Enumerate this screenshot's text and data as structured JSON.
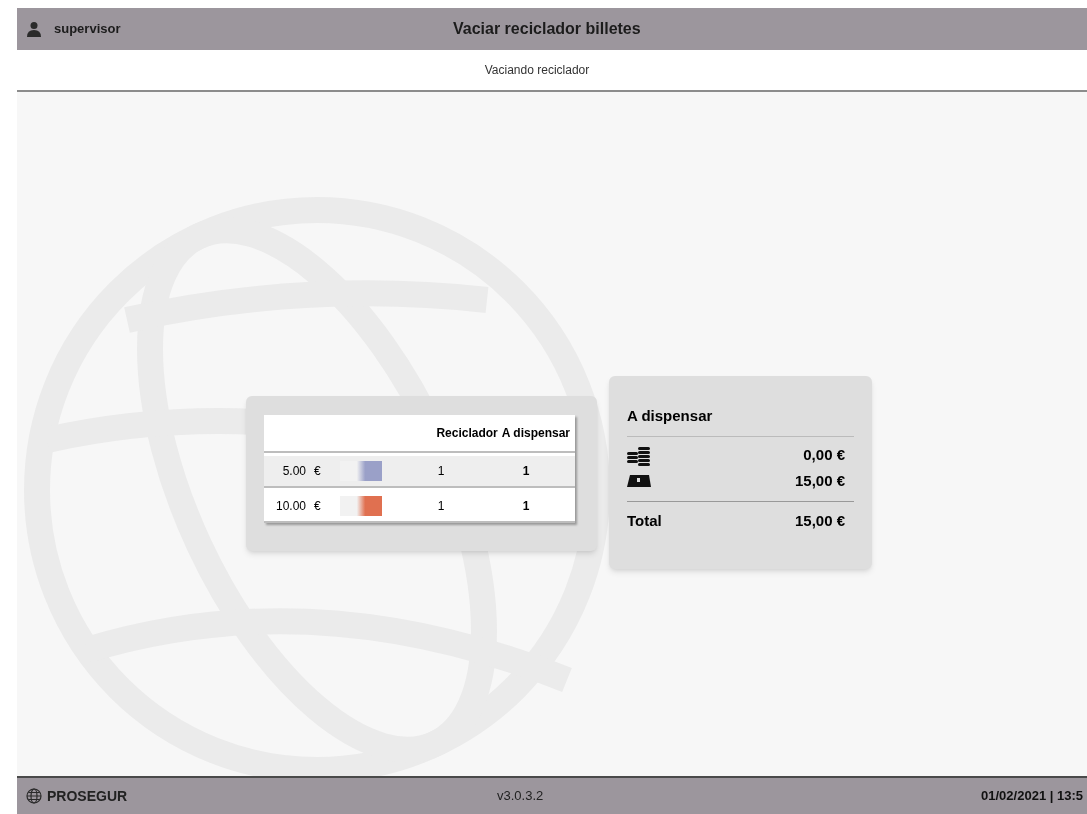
{
  "header": {
    "user": "supervisor",
    "title": "Vaciar reciclador billetes"
  },
  "subheader": {
    "status": "Vaciando reciclador"
  },
  "table": {
    "columns": [
      "Reciclador",
      "A dispensar"
    ],
    "rows": [
      {
        "denomination": "5.00",
        "currency": "€",
        "kind": "note5",
        "recycler": "1",
        "to_dispense": "1"
      },
      {
        "denomination": "10.00",
        "currency": "€",
        "kind": "note10",
        "recycler": "1",
        "to_dispense": "1"
      }
    ]
  },
  "summary": {
    "title": "A dispensar",
    "lines": [
      {
        "kind": "coins",
        "amount": "0,00 €"
      },
      {
        "kind": "notes",
        "amount": "15,00 €"
      }
    ],
    "total_label": "Total",
    "total_amount": "15,00 €"
  },
  "footer": {
    "brand": "PROSEGUR",
    "version": "v3.0.3.2",
    "datetime": "01/02/2021 | 13:5"
  }
}
